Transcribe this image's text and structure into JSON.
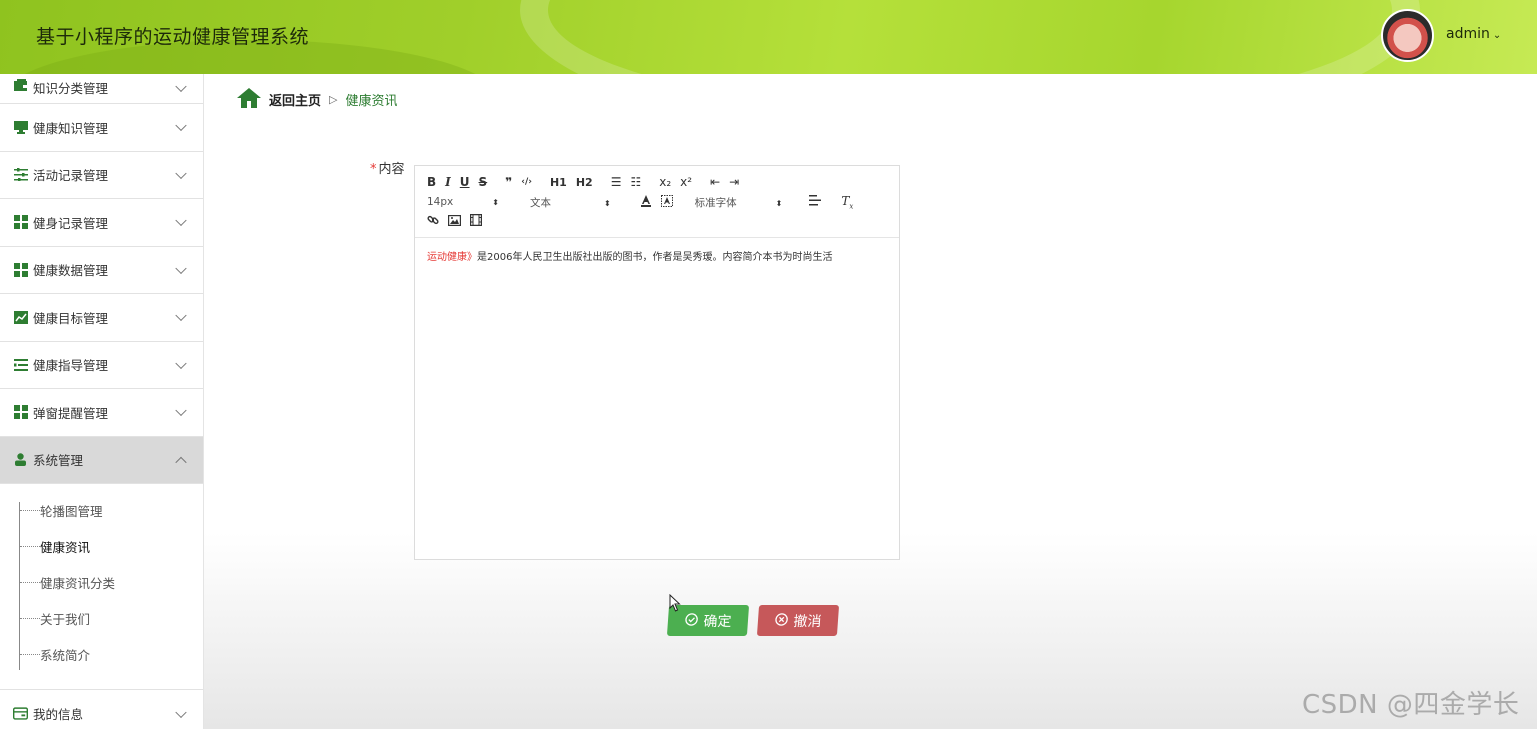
{
  "header": {
    "title": "基于小程序的运动健康管理系统",
    "username": "admin",
    "chevron": "⌄"
  },
  "sidebar": {
    "items": [
      {
        "label": "知识分类管理",
        "icon": "wallet-icon"
      },
      {
        "label": "健康知识管理",
        "icon": "monitor-icon"
      },
      {
        "label": "活动记录管理",
        "icon": "sliders-icon"
      },
      {
        "label": "健身记录管理",
        "icon": "grid-icon"
      },
      {
        "label": "健康数据管理",
        "icon": "grid-icon"
      },
      {
        "label": "健康目标管理",
        "icon": "line-chart-icon"
      },
      {
        "label": "健康指导管理",
        "icon": "list-indent-icon"
      },
      {
        "label": "弹窗提醒管理",
        "icon": "grid-icon"
      },
      {
        "label": "系统管理",
        "icon": "user-icon"
      },
      {
        "label": "我的信息",
        "icon": "card-icon"
      }
    ],
    "submenu": [
      "轮播图管理",
      "健康资讯",
      "健康资讯分类",
      "关于我们",
      "系统简介"
    ]
  },
  "breadcrumb": {
    "home": "返回主页",
    "separator": "▷",
    "current": "健康资讯"
  },
  "form": {
    "required_mark": "*",
    "label": "内容"
  },
  "editor": {
    "row1": [
      "B",
      "I",
      "U",
      "S",
      "❞",
      "‹/›",
      "H1",
      "H2",
      "☰",
      "☷",
      "x₂",
      "x²",
      "⇤",
      "⇥"
    ],
    "font_size": "14px",
    "header_select": "文本",
    "font_family": "标准字体",
    "updown": "⬍",
    "content_highlight": "运动健康》",
    "content_rest": "是2006年人民卫生出版社出版的图书，作者是吴秀瑷。内容简介本书为时尚生活"
  },
  "buttons": {
    "ok": "确定",
    "cancel": "撤消"
  },
  "watermark": "CSDN @四金学长"
}
